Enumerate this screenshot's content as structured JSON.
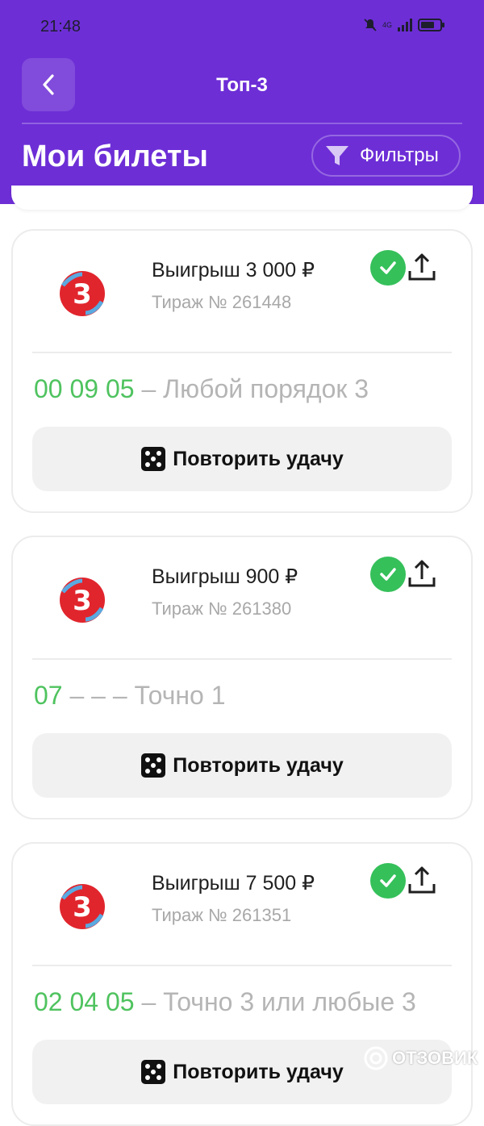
{
  "statusbar": {
    "time": "21:48",
    "network": "4G"
  },
  "nav": {
    "title": "Топ-3",
    "back_icon": "chevron-left-icon"
  },
  "page": {
    "title": "Мои билеты",
    "filter_label": "Фильтры"
  },
  "tickets": [
    {
      "win": "Выигрыш 3 000 ₽",
      "draw": "Тираж № 261448",
      "numbers": "00 09 05",
      "description": " – Любой порядок 3",
      "button": "Повторить удачу"
    },
    {
      "win": "Выигрыш 900 ₽",
      "draw": "Тираж № 261380",
      "numbers": "07",
      "description": " – – – Точно 1",
      "button": "Повторить удачу"
    },
    {
      "win": "Выигрыш 7 500 ₽",
      "draw": "Тираж № 261351",
      "numbers": "02 04 05",
      "description": " – Точно 3 или любые 3",
      "button": "Повторить удачу"
    }
  ],
  "watermark": "ОТЗОВИК",
  "colors": {
    "header": "#6d2ed6",
    "win_numbers": "#4fc35f",
    "check": "#35c05a",
    "logo_red": "#e1252d"
  }
}
